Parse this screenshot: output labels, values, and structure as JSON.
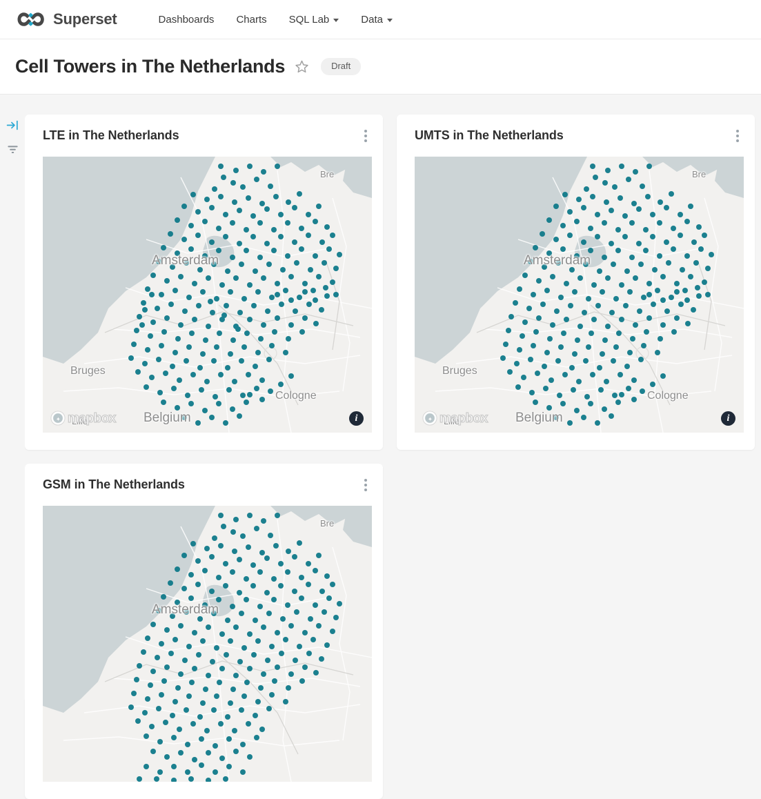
{
  "navbar": {
    "brand": "Superset",
    "brand_icon": "infinity-logo",
    "items": [
      {
        "label": "Dashboards",
        "has_caret": false
      },
      {
        "label": "Charts",
        "has_caret": false
      },
      {
        "label": "SQL Lab",
        "has_caret": true
      },
      {
        "label": "Data",
        "has_caret": true
      }
    ]
  },
  "titlebar": {
    "title": "Cell Towers in The Netherlands",
    "favorite_icon": "star-outline-icon",
    "status_badge": "Draft"
  },
  "rail": {
    "expand_icon": "arrow-to-line-right-icon",
    "filter_icon": "filter-icon",
    "expand_color": "#2ba8d4",
    "filter_color": "#9aa3ab"
  },
  "charts": [
    {
      "title": "LTE in The Netherlands",
      "menu_icon": "kebab-menu-icon",
      "map": {
        "provider": "mapbox",
        "attribution_icon": "info-icon",
        "labels": [
          "Bre",
          "Amsterdam",
          "Bruges",
          "Lille",
          "Belgium",
          "Cologne"
        ],
        "point_color": "#107a8a"
      }
    },
    {
      "title": "UMTS in The Netherlands",
      "menu_icon": "kebab-menu-icon",
      "map": {
        "provider": "mapbox",
        "attribution_icon": "info-icon",
        "labels": [
          "Bre",
          "Amsterdam",
          "Bruges",
          "Lille",
          "Belgium",
          "Cologne"
        ],
        "point_color": "#107a8a"
      }
    },
    {
      "title": "GSM in The Netherlands",
      "menu_icon": "kebab-menu-icon",
      "map": {
        "provider": "mapbox",
        "attribution_icon": "info-icon",
        "labels": [
          "Bre",
          "Amsterdam"
        ],
        "point_color": "#107a8a"
      }
    }
  ],
  "colors": {
    "page_bg": "#f5f5f5",
    "card_bg": "#ffffff",
    "accent_teal": "#107a8a",
    "accent_blue": "#2ba8d4",
    "sea": "#ccd4d6",
    "land": "#f2f1ef"
  }
}
